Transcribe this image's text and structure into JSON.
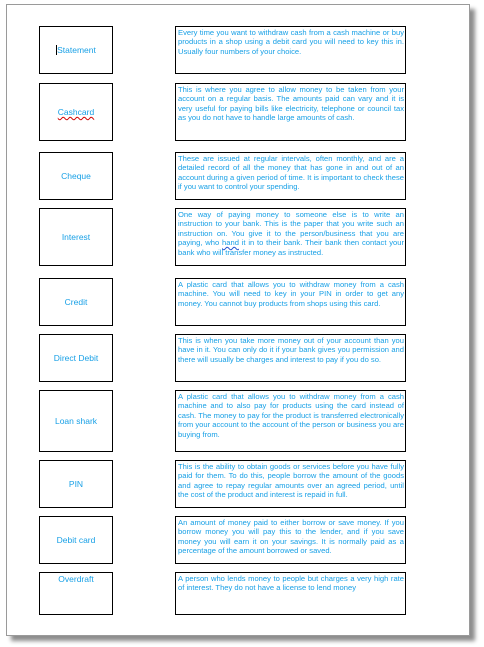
{
  "cards": [
    {
      "term": "Statement",
      "definition": "Every time you want to withdraw cash from a cash machine or buy products in a shop using a debit card you will need to key this in. Usually four numbers of your choice."
    },
    {
      "term": "Cashcard",
      "definition": "This is where you agree to allow money to be taken from your account on a regular basis. The amounts paid can vary and it is very useful for paying bills like electricity, telephone or council tax as you do not have to handle large amounts of cash."
    },
    {
      "term": "Cheque",
      "definition": "These are issued at regular intervals, often monthly, and are a detailed record of all the money that has gone in and out of an account during a given period of time. It is important to check these if you want to control your spending."
    },
    {
      "term": "Interest",
      "definition_parts": [
        "One way of paying money to someone else is to write an instruction to your bank. This is the paper that you write such an instruction on. You give it to the person/business that you are paying, who ",
        "hand",
        " it in to their bank. Their bank then contact your bank who will transfer money as instructed."
      ]
    },
    {
      "term": "Credit",
      "definition": "A plastic card that allows you to withdraw money from a cash machine. You will need to key in your PIN in order to get any money. You cannot buy products from shops using this card."
    },
    {
      "term": "Direct Debit",
      "definition": "This is when you take more money out of your account than you have in it. You can only do it if your bank gives you permission and there will usually be charges and interest to pay if you do so."
    },
    {
      "term": "Loan shark",
      "definition": "A plastic card that allows you to withdraw money from a cash machine and to also pay for products using the card instead of cash. The money to pay for the product is transferred electronically from your account to the account of the person or business you are buying from."
    },
    {
      "term": "PIN",
      "definition": "This is the ability to obtain goods or services before you have fully paid for them. To do this, people borrow the amount of the goods and agree to repay regular amounts over an agreed period, until the cost of the product and interest is repaid in full."
    },
    {
      "term": "Debit card",
      "definition": "An amount of money paid to either borrow or save money. If you borrow money you will pay this to the lender, and if you save money you will earn it on your savings. It is normally paid as a percentage of the amount borrowed or saved."
    },
    {
      "term": "Overdraft",
      "definition": "A person who lends money to people but charges a very high rate of interest. They do not have a license to lend money"
    }
  ],
  "colors": {
    "text": "#18a0e6",
    "border": "#000000",
    "spell_error_underline": "#d00000",
    "grammar_underline": "#2050d0"
  }
}
